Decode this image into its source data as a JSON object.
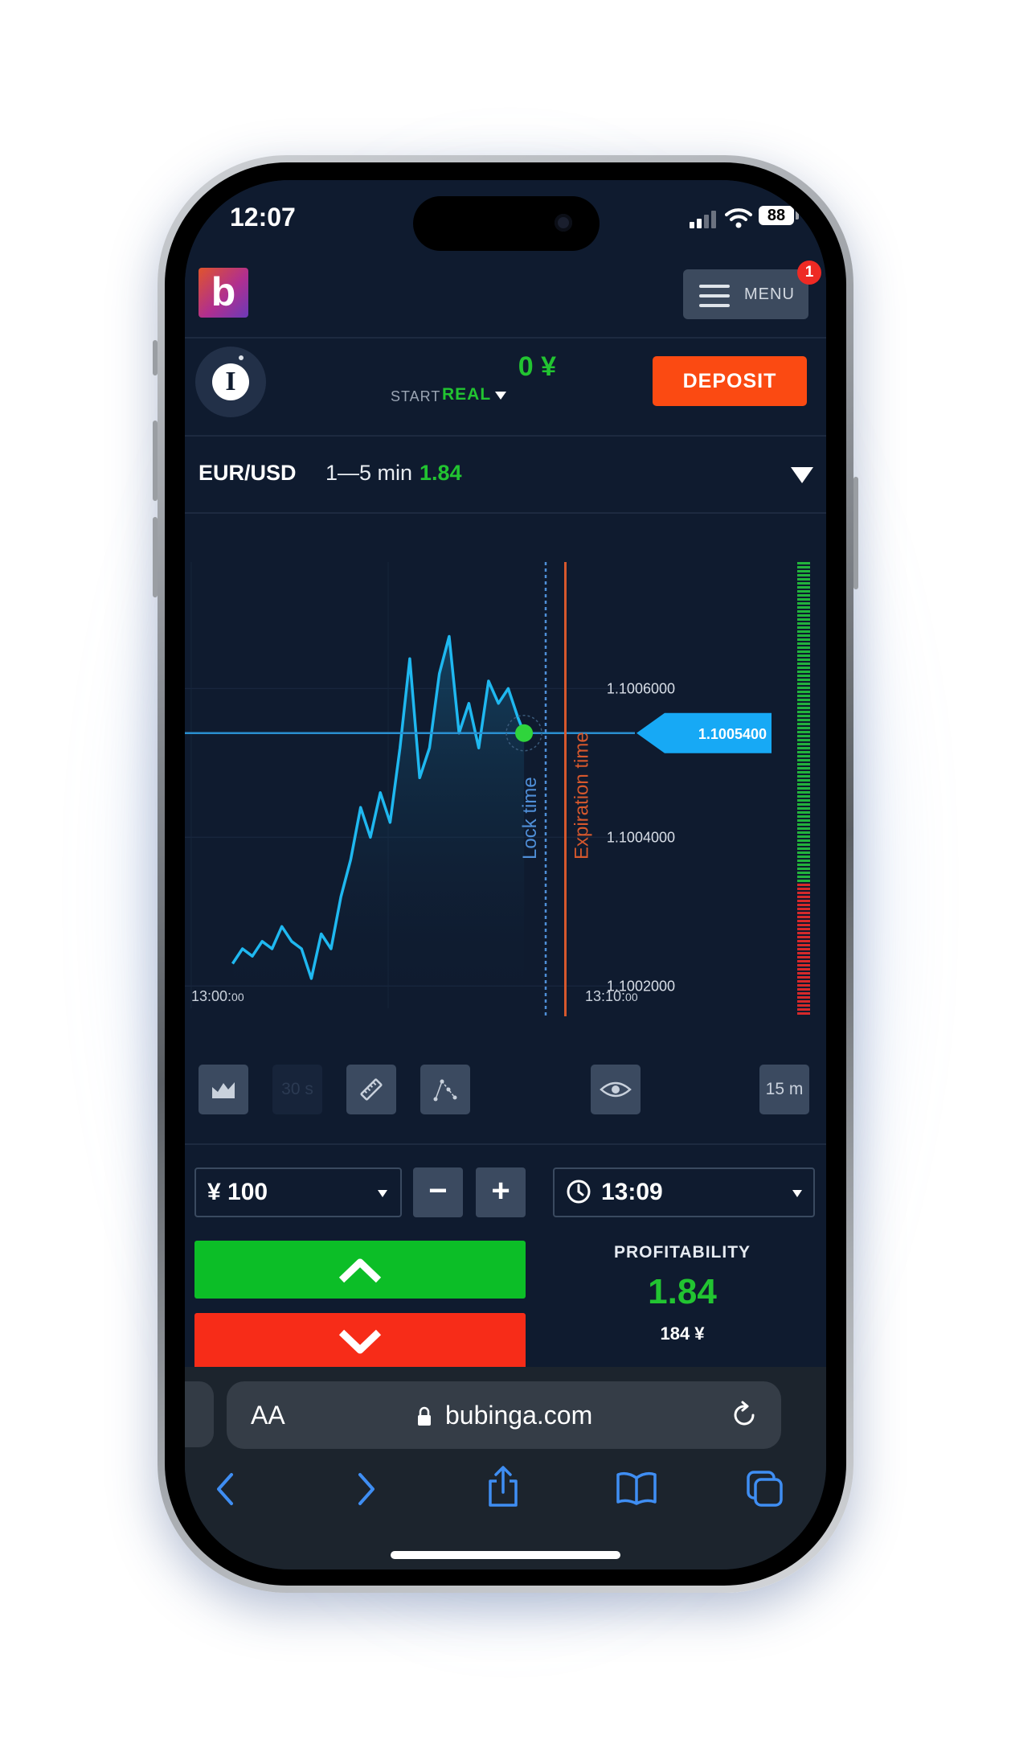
{
  "status_bar": {
    "time": "12:07",
    "battery": "88"
  },
  "header": {
    "logo_letter": "b",
    "menu_label": "MENU",
    "menu_badge": "1"
  },
  "account": {
    "avatar_letter": "I",
    "balance": "0 ¥",
    "start_label": "START",
    "mode_label": "REAL",
    "deposit_label": "DEPOSIT"
  },
  "asset": {
    "pair": "EUR/USD",
    "duration": "1—5 min",
    "payout": "1.84"
  },
  "chart_data": {
    "type": "line",
    "series": [
      {
        "x": [
          "13:01:03",
          "13:01:18",
          "13:01:33",
          "13:01:48",
          "13:02:03",
          "13:02:18",
          "13:02:33",
          "13:02:48",
          "13:03:03",
          "13:03:18",
          "13:03:33",
          "13:03:48",
          "13:04:03",
          "13:04:18",
          "13:04:33",
          "13:04:48",
          "13:05:03",
          "13:05:18",
          "13:05:33",
          "13:05:48",
          "13:06:03",
          "13:06:18",
          "13:06:33",
          "13:06:48",
          "13:07:03",
          "13:07:18",
          "13:07:33",
          "13:07:48",
          "13:08:03",
          "13:08:18",
          "13:08:27"
        ],
        "values": [
          1.10023,
          1.10025,
          1.10024,
          1.10026,
          1.10025,
          1.10028,
          1.10026,
          1.10025,
          1.10021,
          1.10027,
          1.10025,
          1.10032,
          1.10037,
          1.10044,
          1.1004,
          1.10046,
          1.10042,
          1.10052,
          1.10064,
          1.10048,
          1.10052,
          1.10062,
          1.10067,
          1.10054,
          1.10058,
          1.10052,
          1.10061,
          1.10058,
          1.1006,
          1.10056,
          1.10054
        ]
      }
    ],
    "current_price": "1.1005400",
    "y_tick_labels": [
      "1.1006000",
      "1.1004000",
      "1.1002000"
    ],
    "y_ticks": [
      1.1006,
      1.1004,
      1.1002
    ],
    "x_tick_labels": [
      {
        "main": "13:00:",
        "small": "00",
        "t": 0
      },
      {
        "main": "13:10:",
        "small": "00",
        "t": 600
      }
    ],
    "ylim": [
      1.10017,
      1.10077
    ],
    "x_start": "13:00:00",
    "lock_time": "13:09:00",
    "expiration_time": "13:09:30",
    "lock_label": "Lock time",
    "expiration_label": "Expiration time",
    "grid": true,
    "colors": {
      "line": "#1fb8f0",
      "lock": "#4f8fd8",
      "expiration": "#d6582d",
      "marker": "#2fd43c"
    }
  },
  "sentiment": {
    "up_share": 0.7
  },
  "toolbar": {
    "chart_type_icon": "area-chart-icon",
    "timeframe_disabled": "30 s",
    "ruler_icon": "ruler-icon",
    "draw_icon": "drawing-tools-icon",
    "eye_icon": "eye-icon",
    "interval": "15 m"
  },
  "trade": {
    "amount": "¥ 100",
    "minus": "−",
    "plus": "+",
    "expiration": "13:09",
    "profitability_label": "PROFITABILITY",
    "profitability_value": "1.84",
    "profit_amount": "184 ¥"
  },
  "browser": {
    "text_size": "AA",
    "url": "bubinga.com"
  }
}
